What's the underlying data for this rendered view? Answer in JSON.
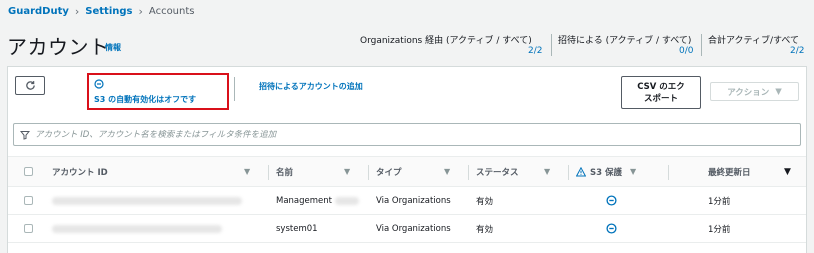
{
  "breadcrumb": {
    "service": "GuardDuty",
    "settings": "Settings",
    "current": "Accounts"
  },
  "page": {
    "title": "アカウント",
    "info": "情報"
  },
  "stats": [
    {
      "label": "Organizations 経由 (アクティブ / すべて)",
      "value": "2/2"
    },
    {
      "label": "招待による (アクティブ / すべて)",
      "value": "0/0"
    },
    {
      "label": "合計アクティブ/すべて",
      "value": "2/2"
    }
  ],
  "toolbar": {
    "s3_auto_enable": "S3 の自動有効化はオフです",
    "invite_link": "招待によるアカウントの追加",
    "csv_export_line1": "CSV のエク",
    "csv_export_line2": "スポート",
    "actions": "アクション"
  },
  "search": {
    "placeholder": "アカウント ID、アカウント名を検索またはフィルタ条件を追加"
  },
  "table": {
    "headers": {
      "account_id": "アカウント ID",
      "name": "名前",
      "type": "タイプ",
      "status": "ステータス",
      "s3": "S3 保護",
      "updated": "最終更新日"
    },
    "rows": [
      {
        "name": "Management",
        "type": "Via Organizations",
        "status": "有効",
        "updated": "1分前"
      },
      {
        "name": "system01",
        "type": "Via Organizations",
        "status": "有効",
        "updated": "1分前"
      }
    ]
  },
  "colors": {
    "link": "#0073bb",
    "highlight": "#d9101a",
    "warning": "#0073bb"
  }
}
